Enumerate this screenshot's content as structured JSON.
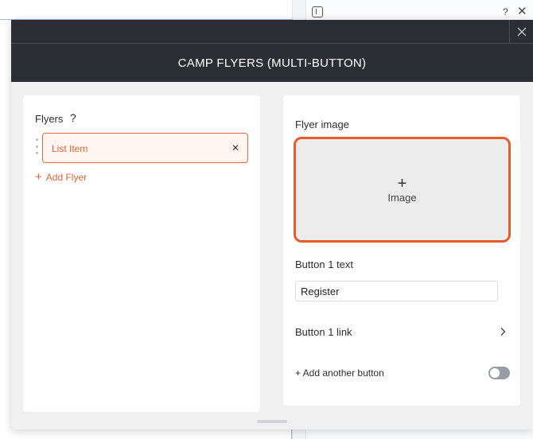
{
  "background": {
    "help_label": "?",
    "close_label": "✕"
  },
  "modal": {
    "title": "CAMP FLYERS (MULTI-BUTTON)",
    "close_icon": "close-icon"
  },
  "left_panel": {
    "flyers_label": "Flyers",
    "help_label": "?",
    "list_items": [
      {
        "label": "List Item",
        "remove_label": "✕"
      }
    ],
    "add_flyer_plus": "+",
    "add_flyer_label": "Add Flyer"
  },
  "right_panel": {
    "flyer_image_label": "Flyer image",
    "image_plus": "+",
    "image_label": "Image",
    "button1_text_label": "Button 1 text",
    "button1_text_value": "Register",
    "button1_link_label": "Button 1 link",
    "add_button_label": "+ Add another button",
    "toggle_on": false
  },
  "colors": {
    "accent": "#e3633a",
    "header_bg": "#2b2e35",
    "toggle_off": "#999ea6"
  }
}
